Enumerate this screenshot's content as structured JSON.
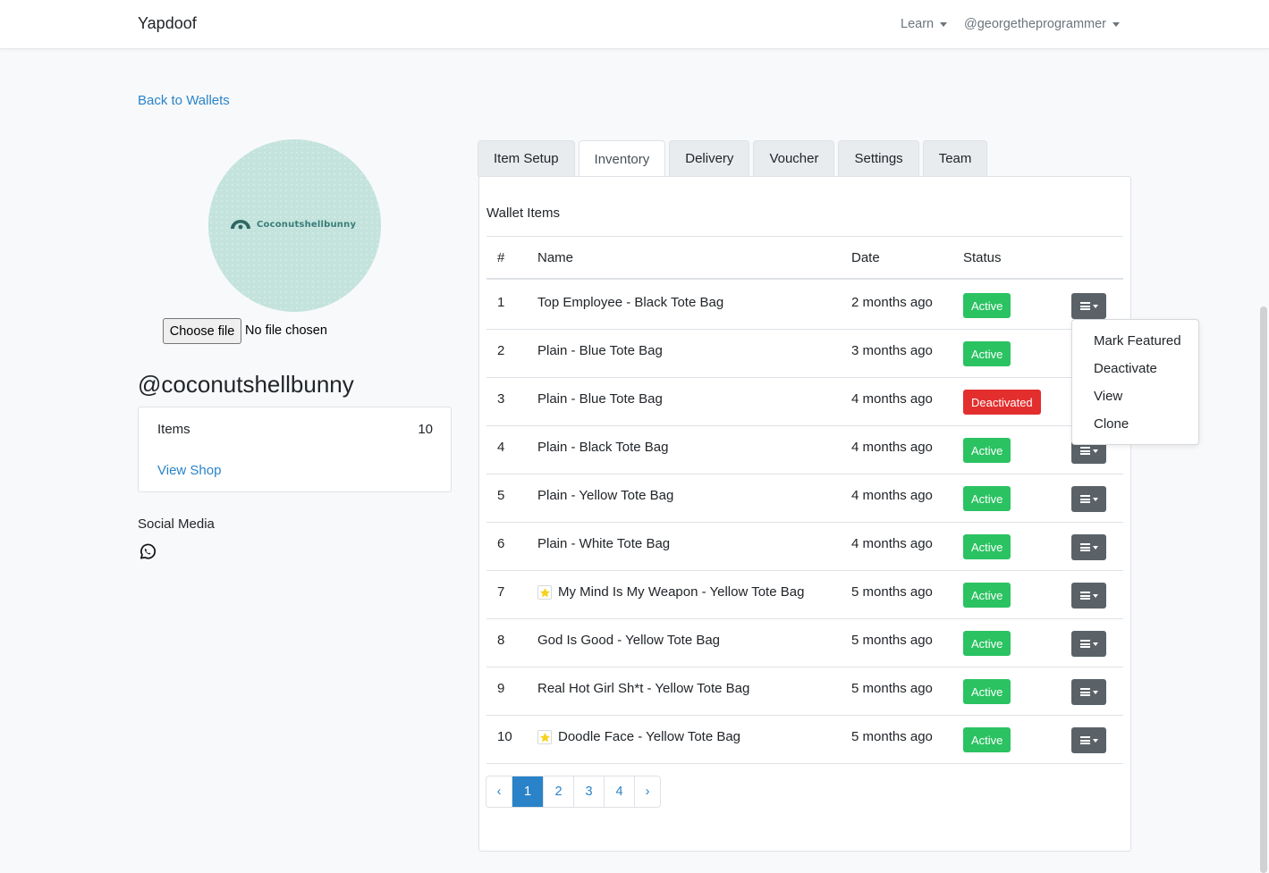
{
  "navbar": {
    "brand": "Yapdoof",
    "learn": "Learn",
    "user": "@georgetheprogrammer"
  },
  "back_link": "Back to Wallets",
  "profile": {
    "logo_text": "Coconutshellbunny",
    "file_button": "Choose file",
    "file_status": "No file chosen",
    "handle": "@coconutshellbunny",
    "items_label": "Items",
    "items_count": "10",
    "view_shop": "View Shop",
    "social_title": "Social Media",
    "social_icon": "whatsapp-icon"
  },
  "tabs": [
    {
      "label": "Item Setup",
      "active": false
    },
    {
      "label": "Inventory",
      "active": true
    },
    {
      "label": "Delivery",
      "active": false
    },
    {
      "label": "Voucher",
      "active": false
    },
    {
      "label": "Settings",
      "active": false
    },
    {
      "label": "Team",
      "active": false
    }
  ],
  "panel": {
    "title": "Wallet Items",
    "columns": {
      "num": "#",
      "name": "Name",
      "date": "Date",
      "status": "Status"
    },
    "rows": [
      {
        "num": "1",
        "name": "Top Employee - Black Tote Bag",
        "date": "2 months ago",
        "status": "Active",
        "featured": false
      },
      {
        "num": "2",
        "name": "Plain - Blue Tote Bag",
        "date": "3 months ago",
        "status": "Active",
        "featured": false
      },
      {
        "num": "3",
        "name": "Plain - Blue Tote Bag",
        "date": "4 months ago",
        "status": "Deactivated",
        "featured": false
      },
      {
        "num": "4",
        "name": "Plain - Black Tote Bag",
        "date": "4 months ago",
        "status": "Active",
        "featured": false
      },
      {
        "num": "5",
        "name": "Plain - Yellow Tote Bag",
        "date": "4 months ago",
        "status": "Active",
        "featured": false
      },
      {
        "num": "6",
        "name": "Plain - White Tote Bag",
        "date": "4 months ago",
        "status": "Active",
        "featured": false
      },
      {
        "num": "7",
        "name": "My Mind Is My Weapon - Yellow Tote Bag",
        "date": "5 months ago",
        "status": "Active",
        "featured": true
      },
      {
        "num": "8",
        "name": "God Is Good - Yellow Tote Bag",
        "date": "5 months ago",
        "status": "Active",
        "featured": false
      },
      {
        "num": "9",
        "name": "Real Hot Girl Sh*t - Yellow Tote Bag",
        "date": "5 months ago",
        "status": "Active",
        "featured": false
      },
      {
        "num": "10",
        "name": "Doodle Face - Yellow Tote Bag",
        "date": "5 months ago",
        "status": "Active",
        "featured": true
      }
    ]
  },
  "dropdown": {
    "items": [
      "Mark Featured",
      "Deactivate",
      "View",
      "Clone"
    ]
  },
  "pagination": {
    "prev": "‹",
    "pages": [
      "1",
      "2",
      "3",
      "4"
    ],
    "current": "1",
    "next": "›"
  },
  "colors": {
    "link": "#2a83c9",
    "active_badge": "#2bc262",
    "deactivated_badge": "#e32e2e",
    "menu_button": "#5a6268",
    "avatar_bg": "#c3e3dc"
  }
}
